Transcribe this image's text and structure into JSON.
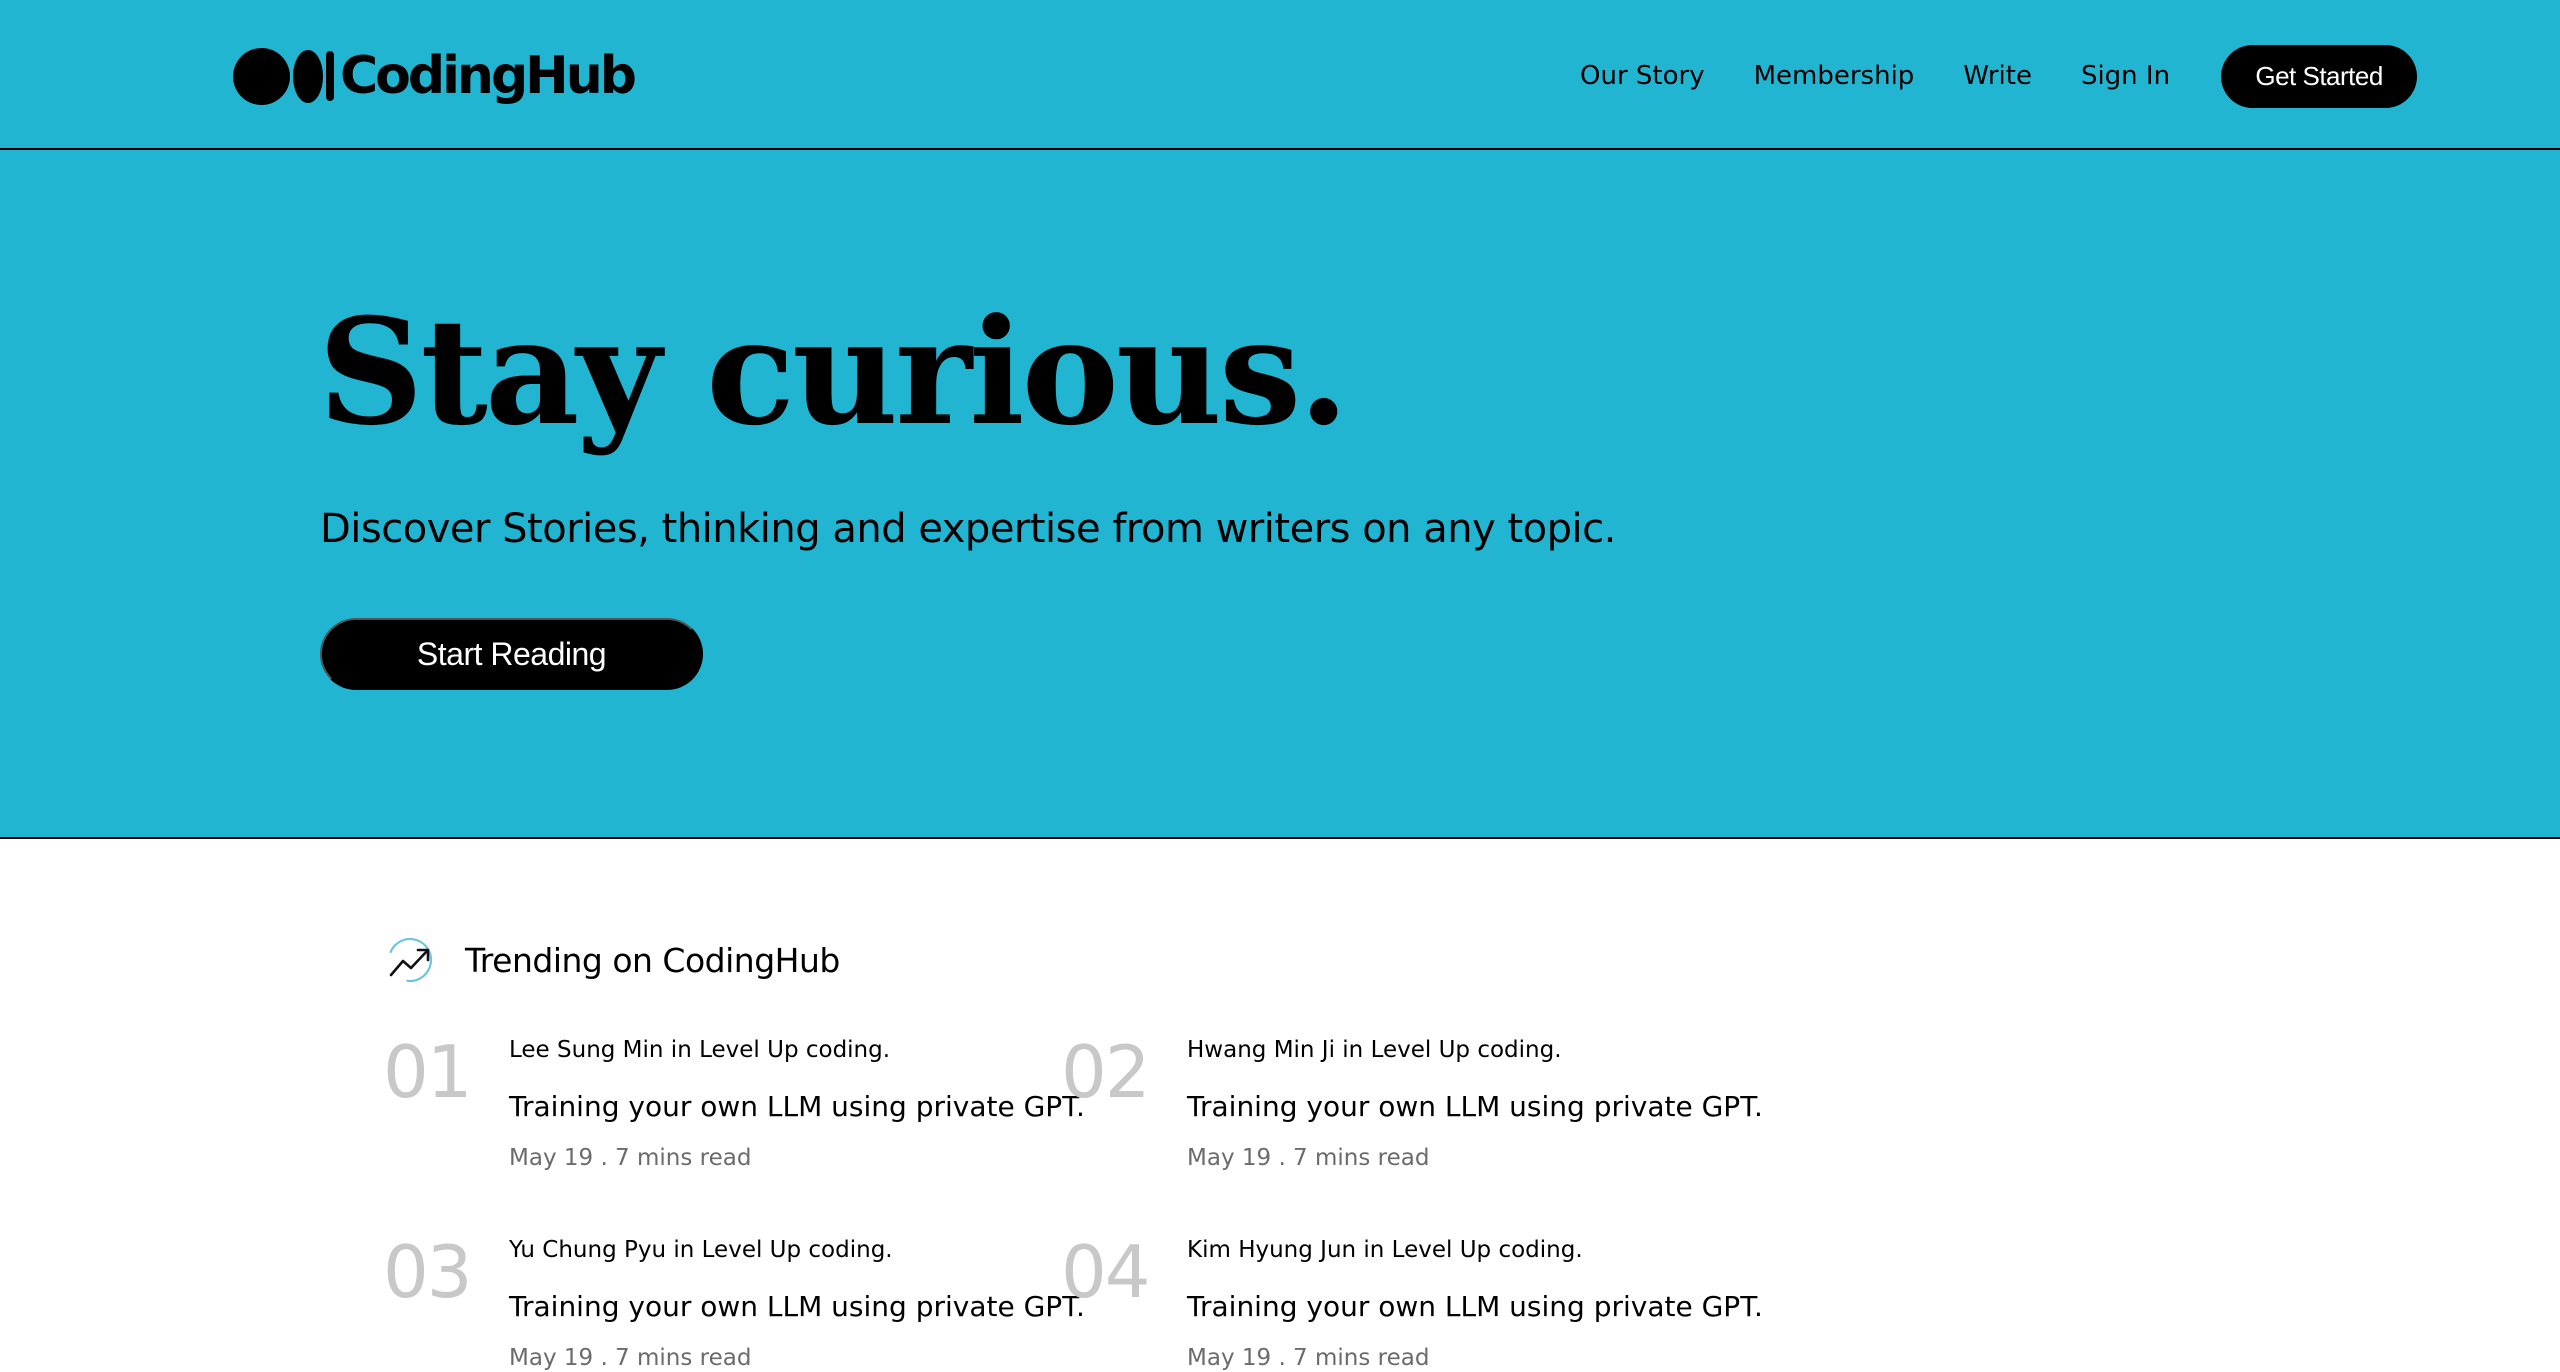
{
  "header": {
    "logo_text": "CodingHub",
    "nav": [
      {
        "label": "Our Story"
      },
      {
        "label": "Membership"
      },
      {
        "label": "Write"
      },
      {
        "label": "Sign In"
      }
    ],
    "cta_label": "Get Started"
  },
  "hero": {
    "title": "Stay curious.",
    "subtitle": "Discover Stories, thinking and expertise from writers on any topic.",
    "button_label": "Start Reading"
  },
  "trending": {
    "icon": "trending-up-icon",
    "title": "Trending on CodingHub",
    "items": [
      {
        "number": "01",
        "author": "Lee Sung Min in Level Up coding.",
        "headline": "Training your own LLM using private GPT.",
        "meta": "May 19 . 7 mins read"
      },
      {
        "number": "02",
        "author": "Hwang Min Ji in Level Up coding.",
        "headline": "Training your own LLM using private GPT.",
        "meta": "May 19 . 7 mins read"
      },
      {
        "number": "03",
        "author": "Yu Chung Pyu in Level Up coding.",
        "headline": "Training your own LLM using private GPT.",
        "meta": "May 19 . 7 mins read"
      },
      {
        "number": "04",
        "author": "Kim Hyung Jun in Level Up coding.",
        "headline": "Training your own LLM using private GPT.",
        "meta": "May 19 . 7 mins read"
      }
    ]
  },
  "colors": {
    "brand_bg": "#22b5d2",
    "button_bg": "#000000",
    "number_gray": "#c8c8c8",
    "meta_gray": "#6b6b6b"
  }
}
